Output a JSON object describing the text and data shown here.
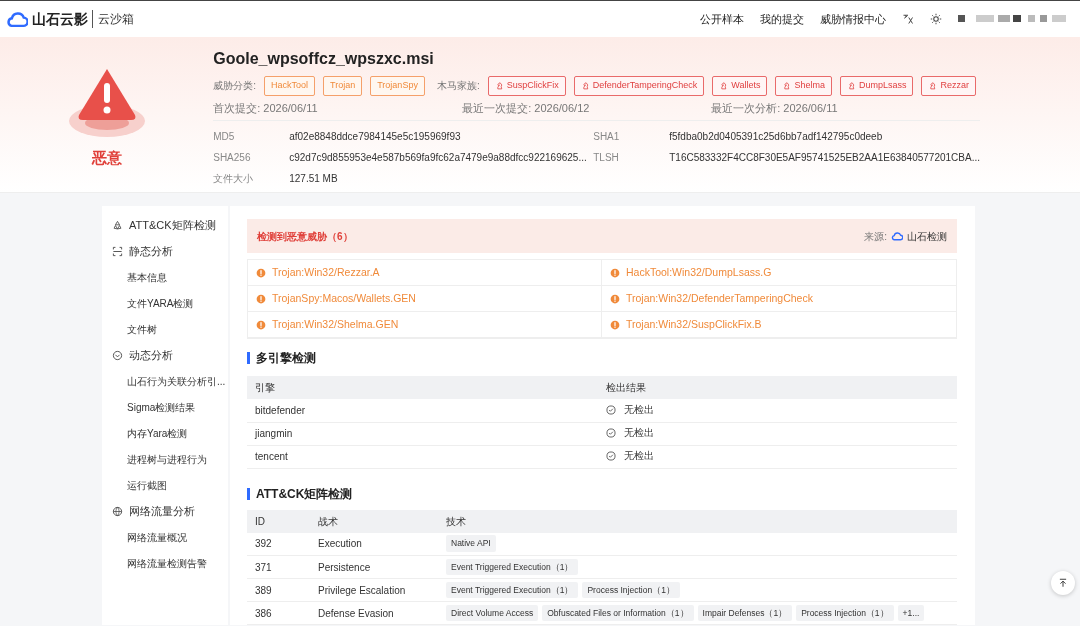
{
  "header": {
    "brand": "山石云影",
    "product": "云沙箱",
    "nav": [
      "公开样本",
      "我的提交",
      "威胁情报中心"
    ]
  },
  "sample": {
    "verdict": "恶意",
    "filename": "Goole_wpsoffcz_wpszxc.msi",
    "threat_label": "威胁分类:",
    "threat_tags": [
      "HackTool",
      "Trojan",
      "TrojanSpy"
    ],
    "family_label": "木马家族:",
    "family_tags": [
      "SuspClickFix",
      "DefenderTamperingCheck",
      "Wallets",
      "Shelma",
      "DumpLsass",
      "Rezzar"
    ],
    "dates": [
      {
        "label": "首次提交:",
        "value": "2026/06/11"
      },
      {
        "label": "最近一次提交:",
        "value": "2026/06/12"
      },
      {
        "label": "最近一次分析:",
        "value": "2026/06/11"
      }
    ],
    "hashes": [
      {
        "label": "MD5",
        "value": "af02e8848ddce7984145e5c195969f93"
      },
      {
        "label": "SHA1",
        "value": "f5fdba0b2d0405391c25d6bb7adf142795c0deeb"
      },
      {
        "label": "SHA256",
        "value": "c92d7c9d855953e4e587b569fa9fc62a7479e9a88dfcc922169625..."
      },
      {
        "label": "TLSH",
        "value": "T16C583332F4CC8F30E5AF95741525EB2AA1E63840577201CBA..."
      },
      {
        "label": "文件大小",
        "value": "127.51 MB"
      }
    ]
  },
  "sidebar": {
    "items": [
      {
        "label": "ATT&CK矩阵检测"
      },
      {
        "label": "静态分析",
        "children": [
          {
            "label": "基本信息"
          },
          {
            "label": "文件YARA检测"
          },
          {
            "label": "文件树"
          }
        ]
      },
      {
        "label": "动态分析",
        "children": [
          {
            "label": "山石行为关联分析引..."
          },
          {
            "label": "Sigma检测结果"
          },
          {
            "label": "内存Yara检测"
          },
          {
            "label": "进程树与进程行为"
          },
          {
            "label": "运行截图"
          }
        ]
      },
      {
        "label": "网络流量分析",
        "children": [
          {
            "label": "网络流量概况"
          },
          {
            "label": "网络流量检测告警"
          }
        ]
      }
    ]
  },
  "detection": {
    "title": "检测到恶意威胁（6）",
    "source_label": "来源:",
    "source": "山石检测",
    "threats": [
      "Trojan:Win32/Rezzar.A",
      "HackTool:Win32/DumpLsass.G",
      "TrojanSpy:Macos/Wallets.GEN",
      "Trojan:Win32/DefenderTamperingCheck",
      "Trojan:Win32/Shelma.GEN",
      "Trojan:Win32/SuspClickFix.B"
    ]
  },
  "engines": {
    "title": "多引擎检测",
    "columns": [
      "引擎",
      "检出结果"
    ],
    "rows": [
      {
        "engine": "bitdefender",
        "result": "无检出"
      },
      {
        "engine": "jiangmin",
        "result": "无检出"
      },
      {
        "engine": "tencent",
        "result": "无检出"
      }
    ]
  },
  "attck": {
    "title": "ATT&CK矩阵检测",
    "columns": [
      "ID",
      "战术",
      "技术"
    ],
    "rows": [
      {
        "id": "392",
        "tactic": "Execution",
        "techniques": [
          "Native API"
        ]
      },
      {
        "id": "371",
        "tactic": "Persistence",
        "techniques": [
          "Event Triggered Execution（1）"
        ]
      },
      {
        "id": "389",
        "tactic": "Privilege Escalation",
        "techniques": [
          "Event Triggered Execution（1）",
          "Process Injection（1）"
        ]
      },
      {
        "id": "386",
        "tactic": "Defense Evasion",
        "techniques": [
          "Direct Volume Access",
          "Obfuscated Files or Information（1）",
          "Impair Defenses（1）",
          "Process Injection（1）",
          "+1..."
        ]
      }
    ]
  }
}
